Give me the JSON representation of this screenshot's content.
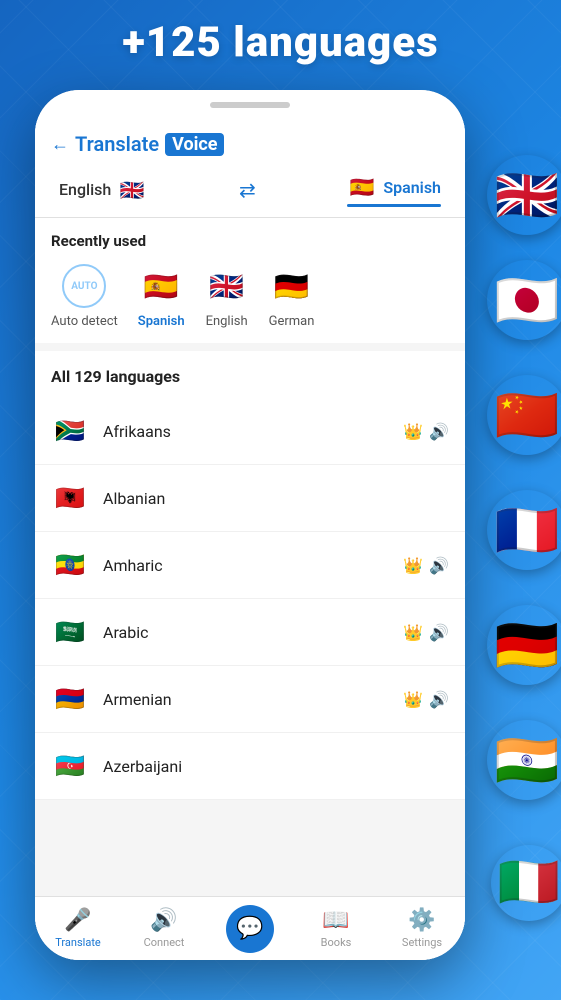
{
  "header": {
    "title": "+125 languages"
  },
  "app": {
    "title_translate": "Translate",
    "title_voice": "Voice",
    "back_label": "←"
  },
  "language_selector": {
    "source_lang": "English",
    "source_flag": "🇬🇧",
    "target_lang": "Spanish",
    "target_flag": "🇪🇸",
    "swap_icon": "⇄"
  },
  "recently_used": {
    "label": "Recently used",
    "items": [
      {
        "id": "auto",
        "label": "Auto detect",
        "flag": "AUTO"
      },
      {
        "id": "spanish",
        "label": "Spanish",
        "flag": "🇪🇸"
      },
      {
        "id": "english",
        "label": "English",
        "flag": "🇬🇧"
      },
      {
        "id": "german",
        "label": "German",
        "flag": "🇩🇪"
      }
    ]
  },
  "all_languages": {
    "label": "All 129 languages",
    "items": [
      {
        "name": "Afrikaans",
        "flag": "🇿🇦",
        "crown": true,
        "voice": true
      },
      {
        "name": "Albanian",
        "flag": "🇦🇱",
        "crown": false,
        "voice": false
      },
      {
        "name": "Amharic",
        "flag": "🇪🇹",
        "crown": true,
        "voice": true
      },
      {
        "name": "Arabic",
        "flag": "🇸🇦",
        "crown": true,
        "voice": true
      },
      {
        "name": "Armenian",
        "flag": "🇦🇲",
        "crown": true,
        "voice": true
      },
      {
        "name": "Azerbaijani",
        "flag": "🇦🇿",
        "crown": false,
        "voice": false
      }
    ]
  },
  "bottom_nav": {
    "items": [
      {
        "id": "translate",
        "label": "Translate",
        "icon": "🎤",
        "active": true,
        "is_circle": false
      },
      {
        "id": "connect",
        "label": "Connect",
        "icon": "🔊",
        "active": false,
        "is_circle": false
      },
      {
        "id": "chat",
        "label": "",
        "icon": "💬",
        "active": false,
        "is_circle": true
      },
      {
        "id": "books",
        "label": "Books",
        "icon": "📖",
        "active": false,
        "is_circle": false
      },
      {
        "id": "settings",
        "label": "Settings",
        "icon": "⚙",
        "active": false,
        "is_circle": false
      }
    ]
  },
  "floating_flags": [
    {
      "flag": "🇬🇧",
      "class": "ff1"
    },
    {
      "flag": "🇯🇵",
      "class": "ff2"
    },
    {
      "flag": "🇨🇳",
      "class": "ff3"
    },
    {
      "flag": "🇫🇷",
      "class": "ff4"
    },
    {
      "flag": "🇩🇪",
      "class": "ff5"
    },
    {
      "flag": "🇮🇳",
      "class": "ff6"
    },
    {
      "flag": "🇮🇹",
      "class": "ff7"
    }
  ]
}
